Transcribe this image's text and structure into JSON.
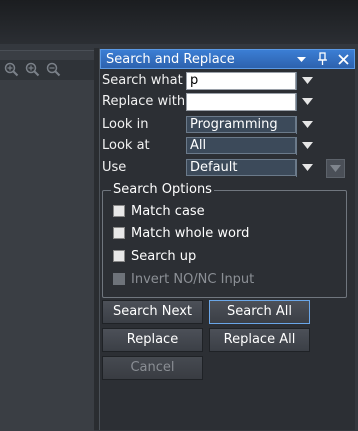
{
  "panel": {
    "title": "Search and Replace",
    "icons": [
      "dropdown-icon",
      "pin-icon",
      "close-icon"
    ]
  },
  "fields": {
    "search_what": {
      "label": "Search what",
      "value": "p"
    },
    "replace_with": {
      "label": "Replace with",
      "value": ""
    },
    "look_in": {
      "label": "Look in",
      "value": "Programming"
    },
    "look_at": {
      "label": "Look at",
      "value": "All"
    },
    "use": {
      "label": "Use",
      "value": "Default"
    }
  },
  "options": {
    "title": "Search Options",
    "match_case": {
      "label": "Match case",
      "checked": false
    },
    "match_whole_word": {
      "label": "Match whole word",
      "checked": false
    },
    "search_up": {
      "label": "Search up",
      "checked": false
    },
    "invert": {
      "label": "Invert NO/NC Input",
      "checked": false,
      "enabled": false
    }
  },
  "buttons": {
    "search_next": "Search Next",
    "search_all": "Search All",
    "replace": "Replace",
    "replace_all": "Replace All",
    "cancel": "Cancel"
  },
  "colors": {
    "title_bar": "#3b7ed4",
    "panel_bg": "#2c2f34",
    "focus_border": "#6aa6e8"
  }
}
